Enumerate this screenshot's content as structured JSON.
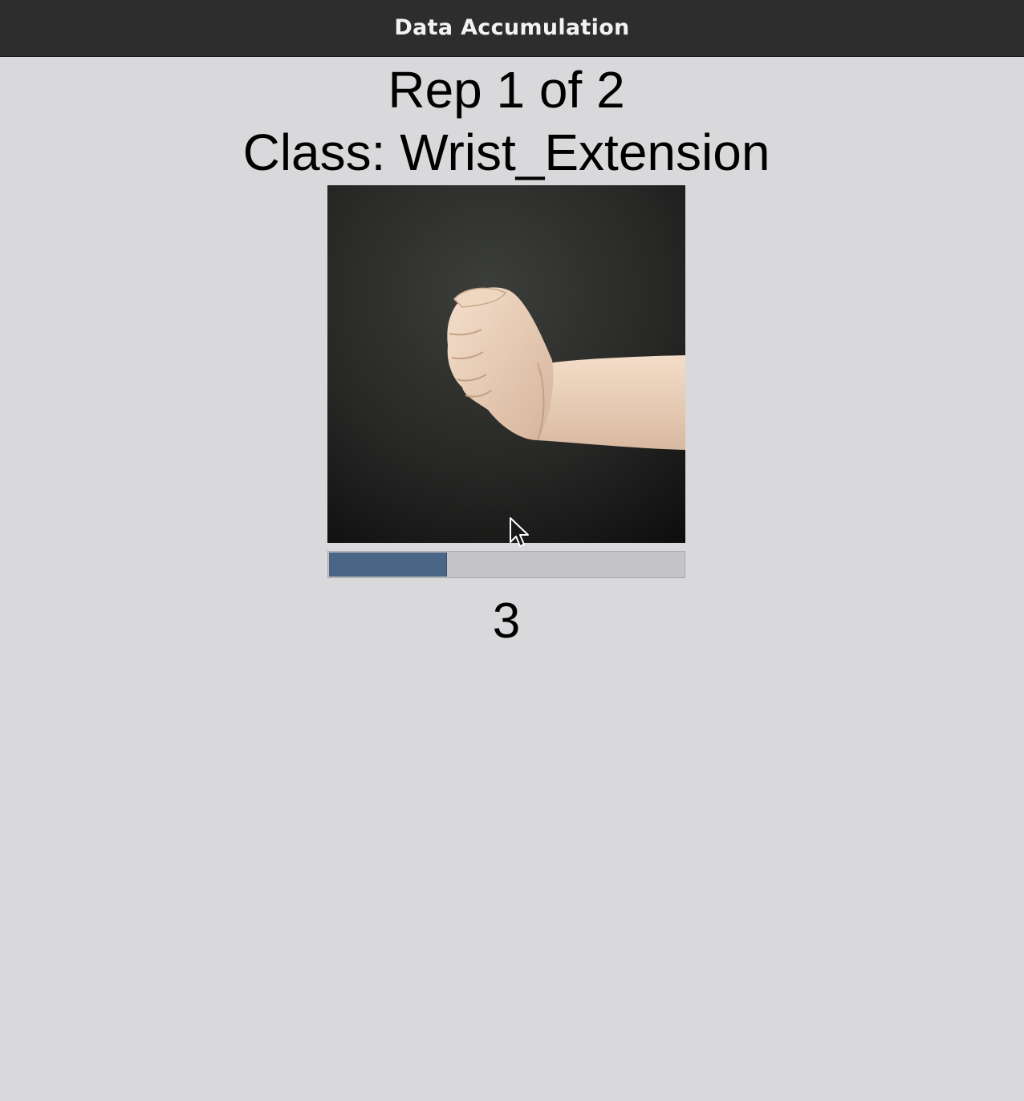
{
  "window": {
    "title": "Data Accumulation"
  },
  "main": {
    "rep_label": "Rep 1 of 2",
    "class_label": "Class: Wrist_Extension",
    "progress_fraction": 0.33,
    "countdown": "3"
  },
  "colors": {
    "titlebar_bg": "#2e2d2e",
    "window_bg": "#d9d9db",
    "progress_fill": "#4a6585",
    "progress_track": "#c4c4c6"
  }
}
